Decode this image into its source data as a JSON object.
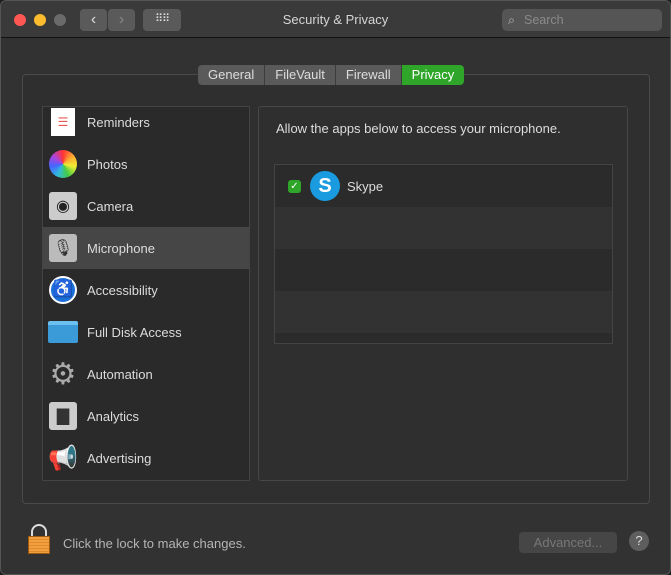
{
  "window": {
    "title": "Security & Privacy",
    "search_placeholder": "Search"
  },
  "tabs": [
    {
      "label": "General"
    },
    {
      "label": "FileVault"
    },
    {
      "label": "Firewall"
    },
    {
      "label": "Privacy",
      "active": true
    }
  ],
  "sidebar": {
    "items": [
      {
        "label": "Reminders",
        "icon": "reminders-icon"
      },
      {
        "label": "Photos",
        "icon": "photos-icon"
      },
      {
        "label": "Camera",
        "icon": "camera-icon"
      },
      {
        "label": "Microphone",
        "icon": "microphone-icon",
        "selected": true
      },
      {
        "label": "Accessibility",
        "icon": "accessibility-icon"
      },
      {
        "label": "Full Disk Access",
        "icon": "folder-icon"
      },
      {
        "label": "Automation",
        "icon": "gear-icon"
      },
      {
        "label": "Analytics",
        "icon": "analytics-icon"
      },
      {
        "label": "Advertising",
        "icon": "megaphone-icon"
      }
    ]
  },
  "panel": {
    "description": "Allow the apps below to access your microphone.",
    "apps": [
      {
        "name": "Skype",
        "checked": true
      }
    ]
  },
  "footer": {
    "lock_text": "Click the lock to make changes.",
    "advanced_label": "Advanced...",
    "help_label": "?"
  },
  "colors": {
    "accent": "#2fa52a"
  }
}
